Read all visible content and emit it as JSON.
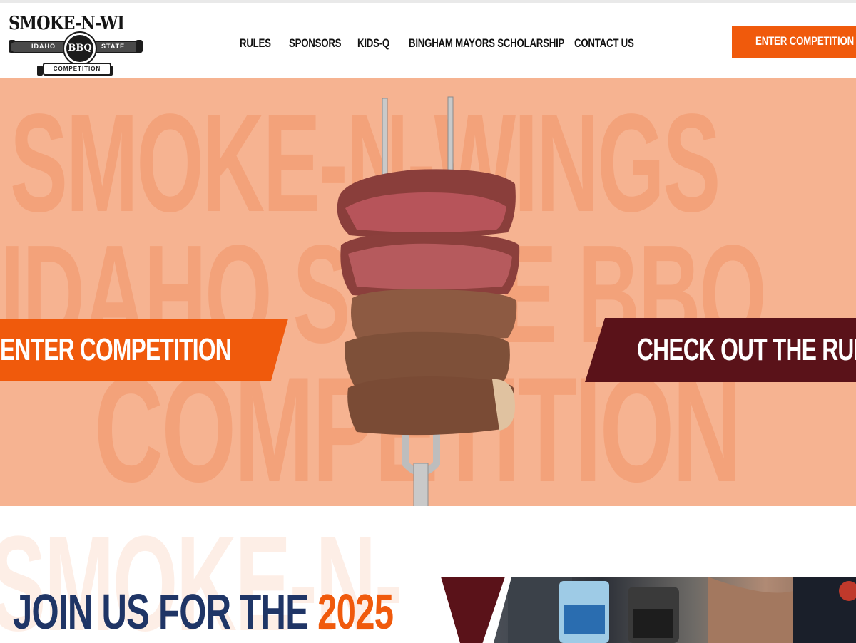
{
  "logo": {
    "title": "SMOKE-N-WINGS",
    "left_word": "IDAHO",
    "badge": "BBQ",
    "right_word": "STATE",
    "subtitle": "COMPETITION"
  },
  "nav": {
    "items": [
      {
        "label": "RULES"
      },
      {
        "label": "SPONSORS"
      },
      {
        "label": "KIDS-Q"
      },
      {
        "label": "BINGHAM MAYORS SCHOLARSHIP"
      },
      {
        "label": "CONTACT US"
      }
    ],
    "cta_label": "ENTER COMPETITION"
  },
  "hero": {
    "bg_lines": [
      "SMOKE-N-WINGS",
      "IDAHO STATE BBQ",
      "COMPETITION"
    ],
    "left_button": "ENTER COMPETITION",
    "right_button": "CHECK OUT THE RULES",
    "background_color": "#f6b391",
    "text_echo_color": "#f3a27a"
  },
  "section": {
    "ghost_text": "SMOKE-N-",
    "heading_prefix": "JOIN US FOR THE",
    "heading_year": "2025"
  },
  "colors": {
    "accent_orange": "#f05a0c",
    "maroon": "#5a1219",
    "navy": "#1f3566"
  }
}
